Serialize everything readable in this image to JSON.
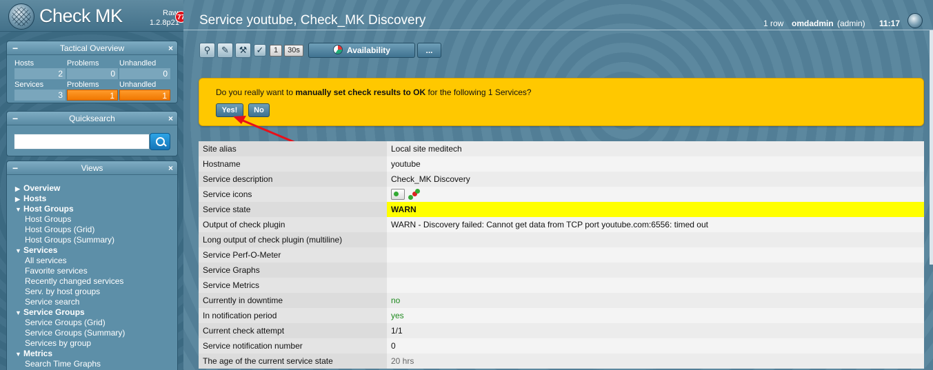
{
  "app": {
    "logo_text": "Check MK",
    "edition": "Raw",
    "version": "1.2.8p21",
    "badge_count": "77"
  },
  "tactical": {
    "title": "Tactical Overview",
    "minimize": "−",
    "close": "×",
    "hosts_label": "Hosts",
    "problems_label": "Problems",
    "unhandled_label": "Unhandled",
    "services_label": "Services",
    "hosts_total": "2",
    "hosts_problems": "0",
    "hosts_unhandled": "0",
    "services_total": "3",
    "services_problems": "1",
    "services_unhandled": "1"
  },
  "quicksearch": {
    "title": "Quicksearch",
    "minimize": "−",
    "close": "×",
    "value": ""
  },
  "views": {
    "title": "Views",
    "minimize": "−",
    "close": "×",
    "items": [
      {
        "label": "Overview",
        "group": true,
        "arrow": "▶"
      },
      {
        "label": "Hosts",
        "group": true,
        "arrow": "▶"
      },
      {
        "label": "Host Groups",
        "group": true,
        "arrow": "▼"
      },
      {
        "label": "Host Groups",
        "group": false
      },
      {
        "label": "Host Groups (Grid)",
        "group": false
      },
      {
        "label": "Host Groups (Summary)",
        "group": false
      },
      {
        "label": "Services",
        "group": true,
        "arrow": "▼"
      },
      {
        "label": "All services",
        "group": false
      },
      {
        "label": "Favorite services",
        "group": false
      },
      {
        "label": "Recently changed services",
        "group": false
      },
      {
        "label": "Serv. by host groups",
        "group": false
      },
      {
        "label": "Service search",
        "group": false
      },
      {
        "label": "Service Groups",
        "group": true,
        "arrow": "▼"
      },
      {
        "label": "Service Groups (Grid)",
        "group": false
      },
      {
        "label": "Service Groups (Summary)",
        "group": false
      },
      {
        "label": "Services by group",
        "group": false
      },
      {
        "label": "Metrics",
        "group": true,
        "arrow": "▼"
      },
      {
        "label": "Search Time Graphs",
        "group": false
      }
    ]
  },
  "header": {
    "title": "Service youtube, Check_MK Discovery",
    "row_count": "1 row",
    "user": "omdadmin",
    "role": "(admin)",
    "time": "11:17"
  },
  "toolbar": {
    "refresh_count": "1",
    "refresh_interval": "30s",
    "availability_label": "Availability",
    "more_label": "..."
  },
  "confirm": {
    "text_before": "Do you really want to ",
    "text_bold": "manually set check results to OK",
    "text_after": " for the following 1 Services?",
    "yes_label": "Yes!",
    "no_label": "No"
  },
  "colors": {
    "accent_yellow": "#ffc800",
    "warn": "#ffff00",
    "alert_orange": "#f07800",
    "ok_green": "#1f8a1f"
  },
  "table": [
    {
      "key": "Site alias",
      "value": "Local site meditech"
    },
    {
      "key": "Hostname",
      "value": "youtube"
    },
    {
      "key": "Service description",
      "value": "Check_MK Discovery"
    },
    {
      "key": "Service icons",
      "value": ""
    },
    {
      "key": "Service state",
      "value": "WARN"
    },
    {
      "key": "Output of check plugin",
      "value": "WARN - Discovery failed: Cannot get data from TCP port youtube.com:6556: timed out"
    },
    {
      "key": "Long output of check plugin (multiline)",
      "value": ""
    },
    {
      "key": "Service Perf-O-Meter",
      "value": ""
    },
    {
      "key": "Service Graphs",
      "value": ""
    },
    {
      "key": "Service Metrics",
      "value": ""
    },
    {
      "key": "Currently in downtime",
      "value": "no"
    },
    {
      "key": "In notification period",
      "value": "yes"
    },
    {
      "key": "Current check attempt",
      "value": "1/1"
    },
    {
      "key": "Service notification number",
      "value": "0"
    },
    {
      "key": "The age of the current service state",
      "value": "20 hrs"
    }
  ]
}
